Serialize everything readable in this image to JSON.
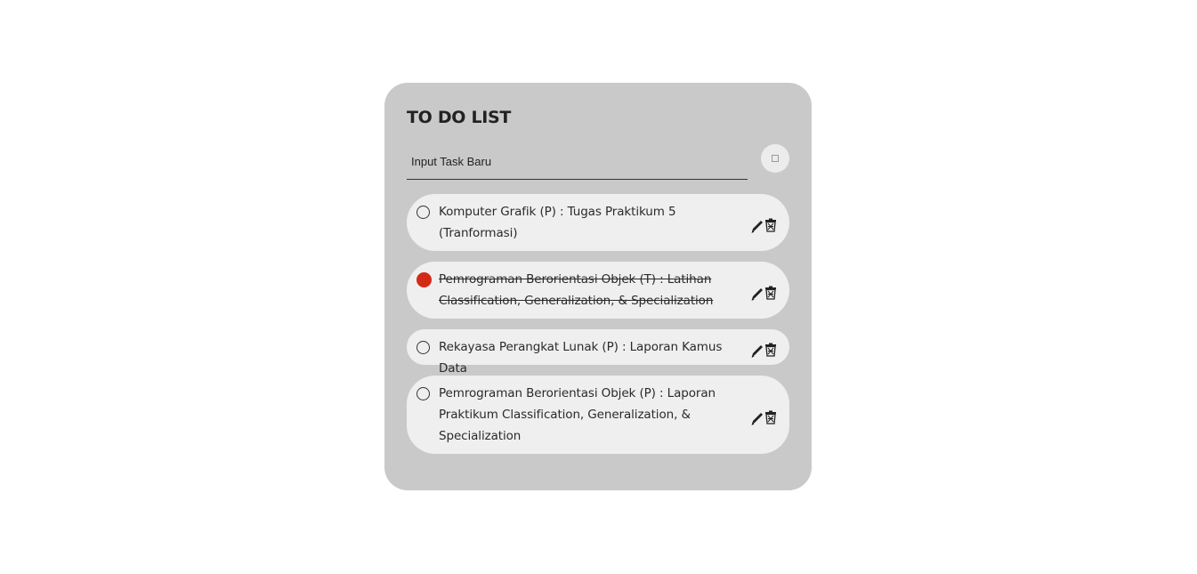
{
  "app": {
    "title": "TO DO LIST"
  },
  "input": {
    "placeholder": "Input Task Baru",
    "value": ""
  },
  "add_button": {
    "icon": "checkbox-icon"
  },
  "tasks": [
    {
      "text": "Komputer Grafik (P) : Tugas Praktikum 5 (Tranformasi)",
      "completed": false
    },
    {
      "text": "Pemrograman Berorientasi Objek (T) : Latihan Classification, Generalization, & Specialization",
      "completed": true
    },
    {
      "text": "Rekayasa Perangkat Lunak (P) : Laporan Kamus Data",
      "completed": false
    },
    {
      "text": "Pemrograman Berorientasi Objek (P) : Laporan Praktikum Classification, Generalization, & Specialization",
      "completed": false
    }
  ],
  "icons": {
    "edit": "pencil-icon",
    "delete": "trash-icon"
  },
  "colors": {
    "card_bg": "#c9c9c9",
    "task_bg": "#efefef",
    "checked_accent": "#d32a16",
    "text": "#2a2a2a"
  }
}
